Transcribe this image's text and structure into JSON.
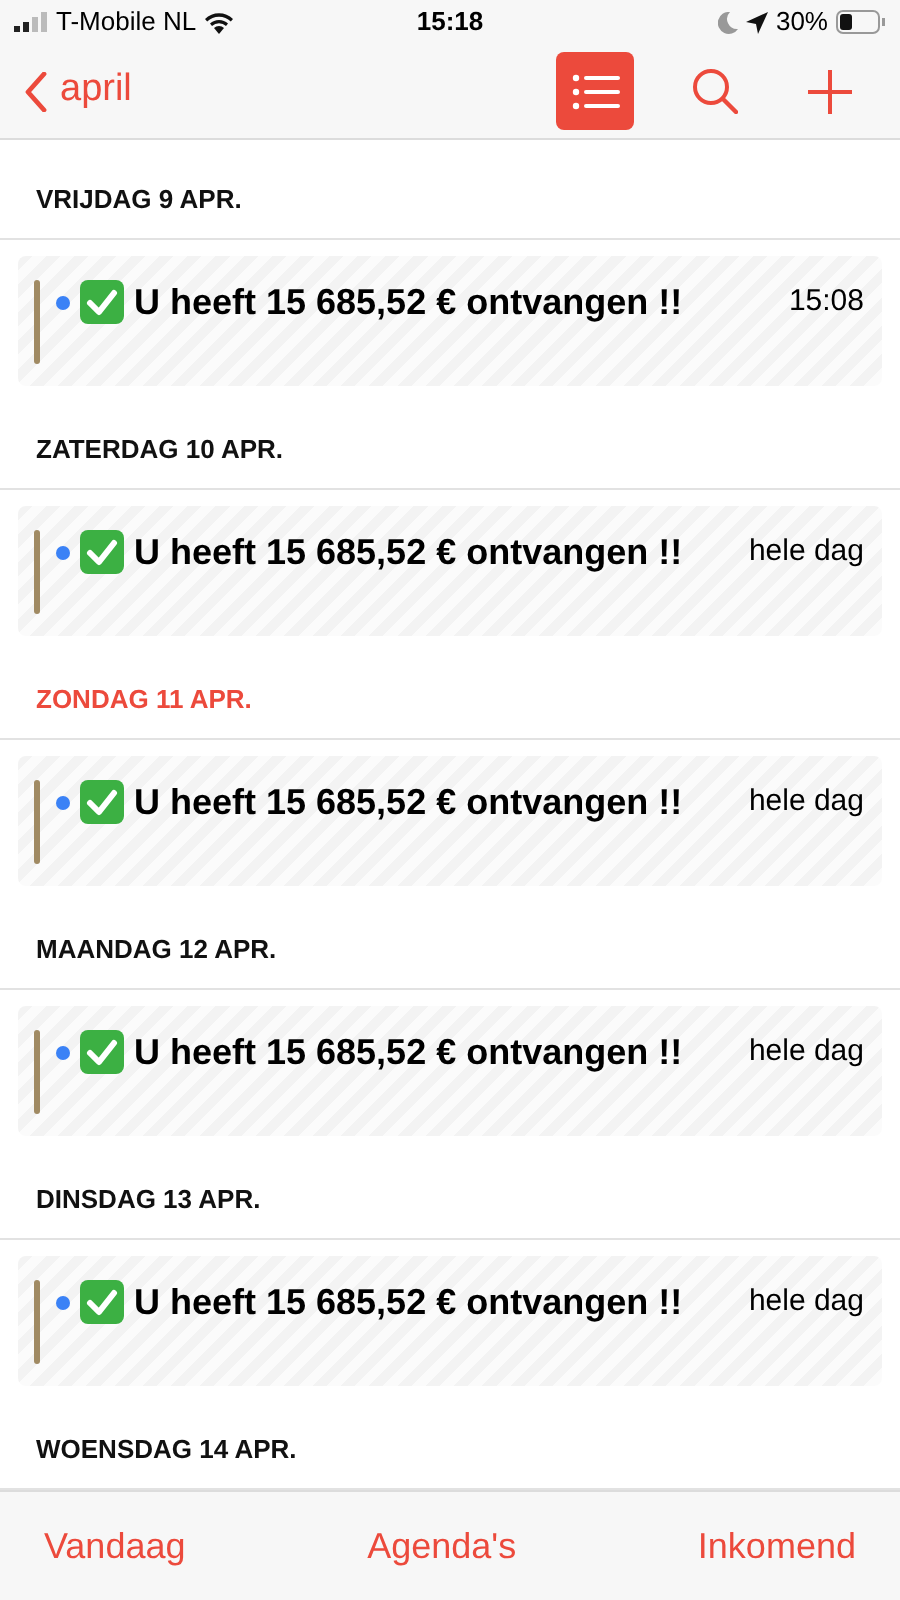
{
  "status_bar": {
    "carrier": "T-Mobile NL",
    "time": "15:18",
    "battery": "30%"
  },
  "nav": {
    "back": "april"
  },
  "days": [
    {
      "label": "VRIJDAG 9 APR.",
      "sunday": false,
      "events": [
        {
          "title": "U heeft 15 685,52 € ontvangen !!",
          "time": "15:08"
        }
      ]
    },
    {
      "label": "ZATERDAG 10 APR.",
      "sunday": false,
      "events": [
        {
          "title": "U heeft 15 685,52 € ontvangen !!",
          "time": "hele dag"
        }
      ]
    },
    {
      "label": "ZONDAG 11 APR.",
      "sunday": true,
      "events": [
        {
          "title": "U heeft 15 685,52 € ontvangen !!",
          "time": "hele dag"
        }
      ]
    },
    {
      "label": "MAANDAG 12 APR.",
      "sunday": false,
      "events": [
        {
          "title": "U heeft 15 685,52 € ontvangen !!",
          "time": "hele dag"
        }
      ]
    },
    {
      "label": "DINSDAG 13 APR.",
      "sunday": false,
      "events": [
        {
          "title": "U heeft 15 685,52 € ontvangen !!",
          "time": "hele dag"
        }
      ]
    },
    {
      "label": "WOENSDAG 14 APR.",
      "sunday": false
    }
  ],
  "toolbar": [
    "Vandaag",
    "Agenda's",
    "Inkomend"
  ]
}
